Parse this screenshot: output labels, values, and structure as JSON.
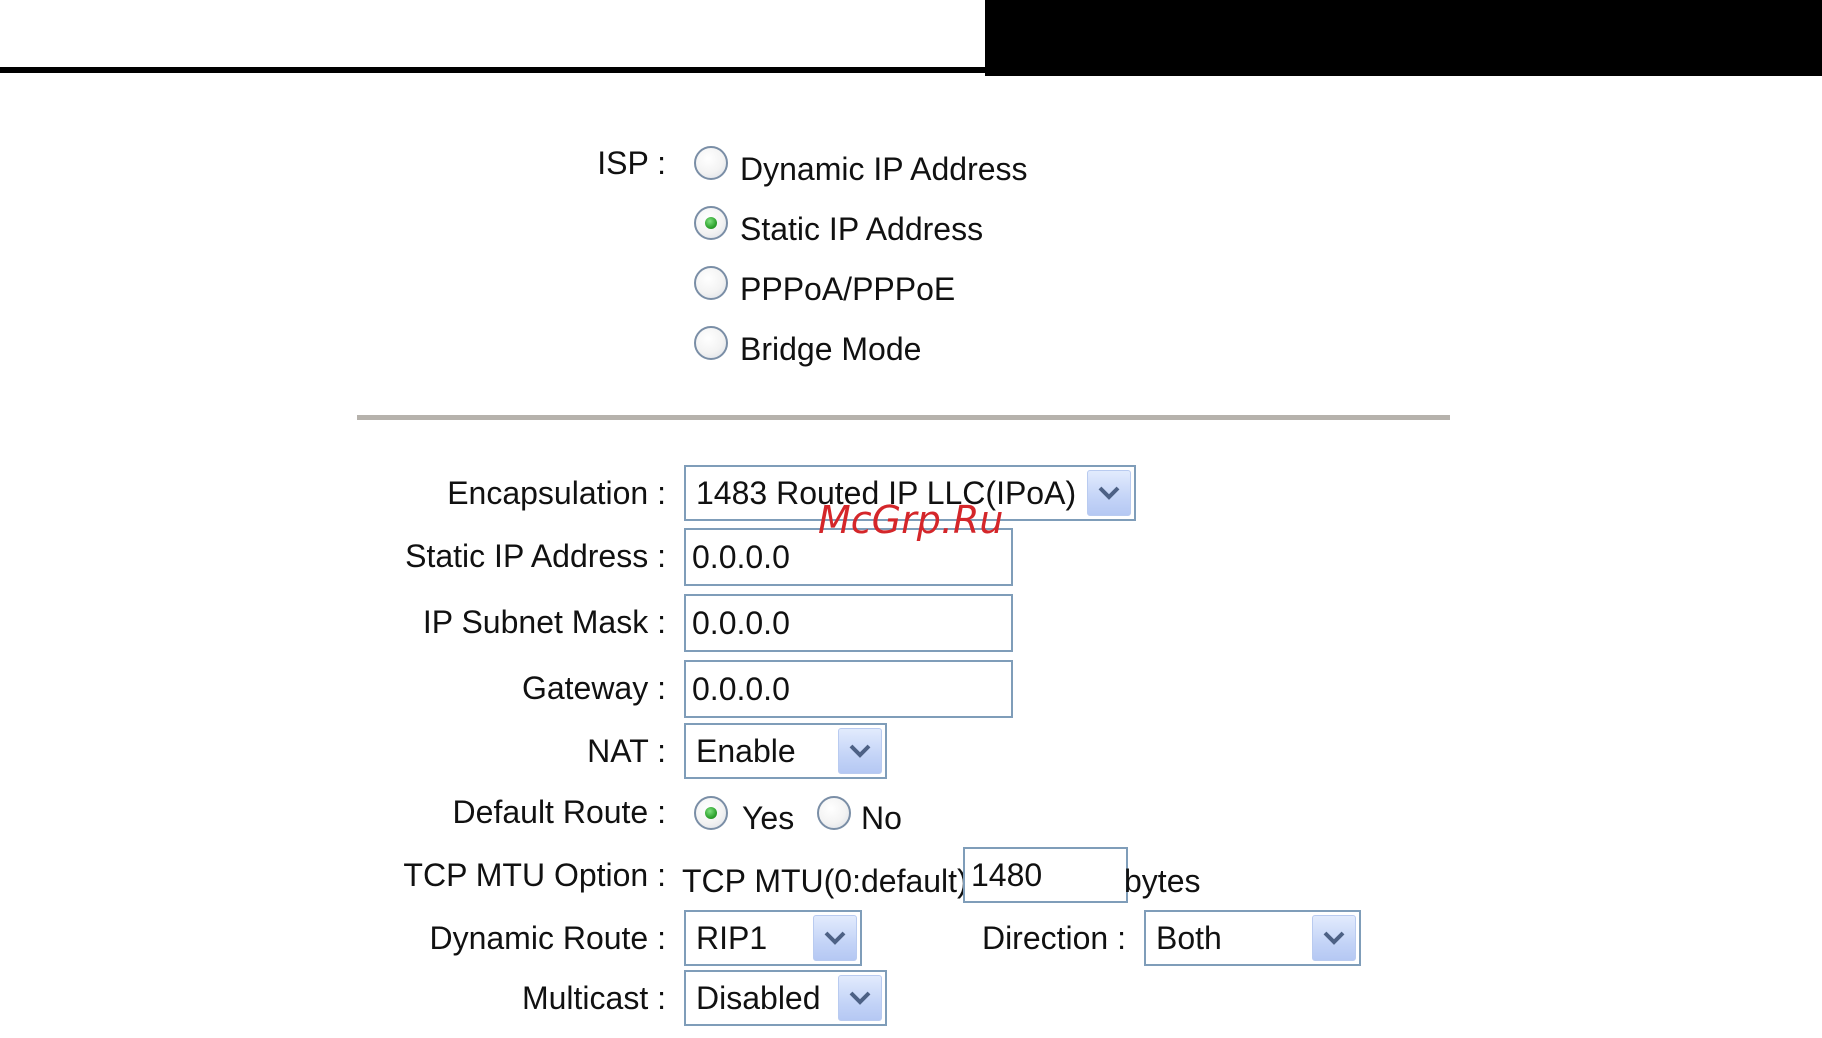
{
  "isp": {
    "label": "ISP :",
    "options": [
      {
        "label": "Dynamic IP Address",
        "selected": false
      },
      {
        "label": "Static IP Address",
        "selected": true
      },
      {
        "label": "PPPoA/PPPoE",
        "selected": false
      },
      {
        "label": "Bridge Mode",
        "selected": false
      }
    ]
  },
  "form": {
    "encapsulation": {
      "label": "Encapsulation :",
      "value": "1483 Routed IP LLC(IPoA)"
    },
    "static_ip": {
      "label": "Static IP Address :",
      "value": "0.0.0.0"
    },
    "subnet_mask": {
      "label": "IP Subnet Mask :",
      "value": "0.0.0.0"
    },
    "gateway": {
      "label": "Gateway :",
      "value": "0.0.0.0"
    },
    "nat": {
      "label": "NAT :",
      "value": "Enable"
    },
    "default_route": {
      "label": "Default Route :",
      "yes_label": "Yes",
      "no_label": "No",
      "selected": "Yes"
    },
    "tcp_mtu": {
      "label": "TCP MTU Option :",
      "prefix": "TCP MTU(0:default)",
      "value": "1480",
      "suffix": "bytes"
    },
    "dynamic_route": {
      "label": "Dynamic Route :",
      "value": "RIP1"
    },
    "direction": {
      "label": "Direction :",
      "value": "Both"
    },
    "multicast": {
      "label": "Multicast :",
      "value": "Disabled"
    }
  },
  "watermark": "McGrp.Ru",
  "colors": {
    "header": "#000000",
    "divider": "#b6b2ac",
    "field_border": "#7f9db9",
    "radio_dot": "#2fa32f",
    "watermark": "#d4262a"
  },
  "icons": {
    "dropdown": "chevron-down-icon",
    "radio": "radio-button-icon"
  }
}
